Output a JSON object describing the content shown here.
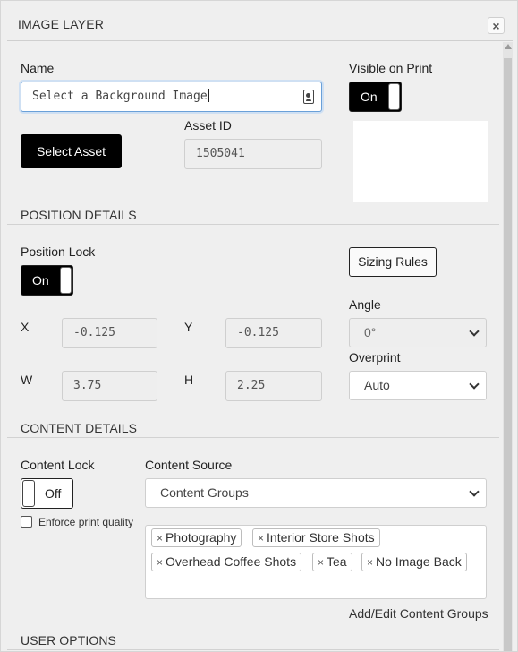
{
  "window": {
    "title": "IMAGE LAYER",
    "close_icon": "×"
  },
  "name_section": {
    "label": "Name",
    "input_value": "Select a Background Image",
    "select_asset_label": "Select Asset",
    "asset_id_label": "Asset ID",
    "asset_id_value": "1505041",
    "visible_on_print_label": "Visible on Print",
    "visible_on_print_toggle": "On"
  },
  "position_details": {
    "section_title": "POSITION DETAILS",
    "position_lock_label": "Position Lock",
    "position_lock_toggle": "On",
    "sizing_rules_label": "Sizing Rules",
    "x_label": "X",
    "x_value": "-0.125",
    "y_label": "Y",
    "y_value": "-0.125",
    "w_label": "W",
    "w_value": "3.75",
    "h_label": "H",
    "h_value": "2.25",
    "angle_label": "Angle",
    "angle_value": "0°",
    "overprint_label": "Overprint",
    "overprint_value": "Auto"
  },
  "content_details": {
    "section_title": "CONTENT DETAILS",
    "content_lock_label": "Content Lock",
    "content_lock_toggle": "Off",
    "enforce_print_quality_label": "Enforce print quality",
    "content_source_label": "Content Source",
    "content_source_value": "Content Groups",
    "tags": [
      "Photography",
      "Interior Store Shots",
      "Overhead Coffee Shots",
      "Tea",
      "No Image Back"
    ],
    "tag_remove_glyph": "×",
    "add_edit_link": "Add/Edit Content Groups"
  },
  "user_options": {
    "section_title": "USER OPTIONS"
  },
  "colors": {
    "panel_bg": "#efefef",
    "toggle_on": "#000000",
    "focus_border": "#6aa0d8"
  }
}
